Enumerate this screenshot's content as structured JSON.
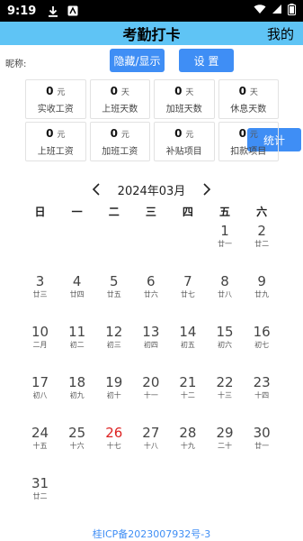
{
  "status_bar": {
    "time": "9:19"
  },
  "header": {
    "title": "考勤打卡",
    "mine": "我的"
  },
  "toolbar": {
    "nickname_label": "昵称:",
    "hide_show_label": "隐藏/显示",
    "settings_label": "设 置",
    "stats_label": "统计"
  },
  "stats": [
    {
      "value": "0",
      "unit": "元",
      "label": "实收工资"
    },
    {
      "value": "0",
      "unit": "天",
      "label": "上班天数"
    },
    {
      "value": "0",
      "unit": "天",
      "label": "加班天数"
    },
    {
      "value": "0",
      "unit": "天",
      "label": "休息天数"
    },
    {
      "value": "0",
      "unit": "元",
      "label": "上班工资"
    },
    {
      "value": "0",
      "unit": "元",
      "label": "加班工资"
    },
    {
      "value": "0",
      "unit": "元",
      "label": "补贴项目"
    },
    {
      "value": "0",
      "unit": "元",
      "label": "扣款项目"
    }
  ],
  "calendar": {
    "month_label": "2024年03月",
    "prev_icon": "chevron-left",
    "next_icon": "chevron-right",
    "weekdays": [
      "日",
      "一",
      "二",
      "三",
      "四",
      "五",
      "六"
    ],
    "today": "26",
    "today_color": "#dd2222",
    "weeks": [
      [
        null,
        null,
        null,
        null,
        null,
        {
          "d": "1",
          "l": "廿一"
        },
        {
          "d": "2",
          "l": "廿二"
        }
      ],
      [
        {
          "d": "3",
          "l": "廿三"
        },
        {
          "d": "4",
          "l": "廿四"
        },
        {
          "d": "5",
          "l": "廿五"
        },
        {
          "d": "6",
          "l": "廿六"
        },
        {
          "d": "7",
          "l": "廿七"
        },
        {
          "d": "8",
          "l": "廿八"
        },
        {
          "d": "9",
          "l": "廿九"
        }
      ],
      [
        {
          "d": "10",
          "l": "二月"
        },
        {
          "d": "11",
          "l": "初二"
        },
        {
          "d": "12",
          "l": "初三"
        },
        {
          "d": "13",
          "l": "初四"
        },
        {
          "d": "14",
          "l": "初五"
        },
        {
          "d": "15",
          "l": "初六"
        },
        {
          "d": "16",
          "l": "初七"
        }
      ],
      [
        {
          "d": "17",
          "l": "初八"
        },
        {
          "d": "18",
          "l": "初九"
        },
        {
          "d": "19",
          "l": "初十"
        },
        {
          "d": "20",
          "l": "十一"
        },
        {
          "d": "21",
          "l": "十二"
        },
        {
          "d": "22",
          "l": "十三"
        },
        {
          "d": "23",
          "l": "十四"
        }
      ],
      [
        {
          "d": "24",
          "l": "十五"
        },
        {
          "d": "25",
          "l": "十六"
        },
        {
          "d": "26",
          "l": "十七"
        },
        {
          "d": "27",
          "l": "十八"
        },
        {
          "d": "28",
          "l": "十九"
        },
        {
          "d": "29",
          "l": "二十"
        },
        {
          "d": "30",
          "l": "廿一"
        }
      ],
      [
        {
          "d": "31",
          "l": "廿二"
        },
        null,
        null,
        null,
        null,
        null,
        null
      ]
    ]
  },
  "footer": {
    "icp": "桂ICP备2023007932号-3"
  },
  "colors": {
    "header_bg": "#5fc4f5",
    "button_bg": "#3f8ef5",
    "link": "#3f8ef5"
  }
}
